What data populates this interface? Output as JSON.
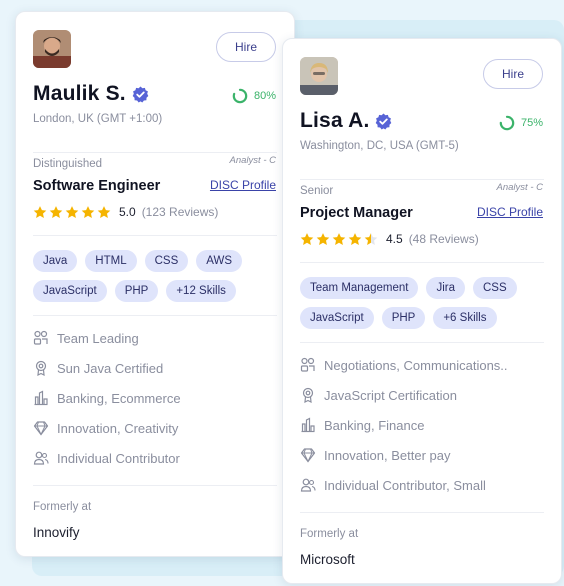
{
  "cards": [
    {
      "name": "Maulik S.",
      "hire_label": "Hire",
      "score": "80%",
      "score_fraction": 0.8,
      "location": "London, UK (GMT +1:00)",
      "level": "Distinguished",
      "analyst": "Analyst - C",
      "role": "Software Engineer",
      "disc_label": "DISC Profile",
      "rating": "5.0",
      "rating_value": 5.0,
      "reviews": "(123 Reviews)",
      "tags": [
        "Java",
        "HTML",
        "CSS",
        "AWS",
        "JavaScript",
        "PHP",
        "+12 Skills"
      ],
      "attributes": [
        {
          "icon": "team-icon",
          "text": "Team Leading"
        },
        {
          "icon": "certificate-icon",
          "text": "Sun Java Certified"
        },
        {
          "icon": "industry-icon",
          "text": "Banking, Ecommerce"
        },
        {
          "icon": "diamond-icon",
          "text": "Innovation, Creativity"
        },
        {
          "icon": "people-icon",
          "text": "Individual Contributor"
        }
      ],
      "formerly_label": "Formerly at",
      "company": "Innovify"
    },
    {
      "name": "Lisa A.",
      "hire_label": "Hire",
      "score": "75%",
      "score_fraction": 0.75,
      "location": "Washington, DC, USA (GMT-5)",
      "level": "Senior",
      "analyst": "Analyst - C",
      "role": "Project Manager",
      "disc_label": "DISC Profile",
      "rating": "4.5",
      "rating_value": 4.5,
      "reviews": "(48 Reviews)",
      "tags": [
        "Team Management",
        "Jira",
        "CSS",
        "JavaScript",
        "PHP",
        "+6 Skills"
      ],
      "attributes": [
        {
          "icon": "team-icon",
          "text": "Negotiations, Communications.."
        },
        {
          "icon": "certificate-icon",
          "text": "JavaScript Certification"
        },
        {
          "icon": "industry-icon",
          "text": "Banking, Finance"
        },
        {
          "icon": "diamond-icon",
          "text": "Innovation, Better pay"
        },
        {
          "icon": "people-icon",
          "text": "Individual Contributor, Small"
        }
      ],
      "formerly_label": "Formerly at",
      "company": "Microsoft"
    }
  ],
  "colors": {
    "score_green": "#3bb36a",
    "star_gold": "#f5b400",
    "tag_bg": "#dfe4fb",
    "link_blue": "#3a43a8",
    "verified_blue": "#5763d6"
  }
}
